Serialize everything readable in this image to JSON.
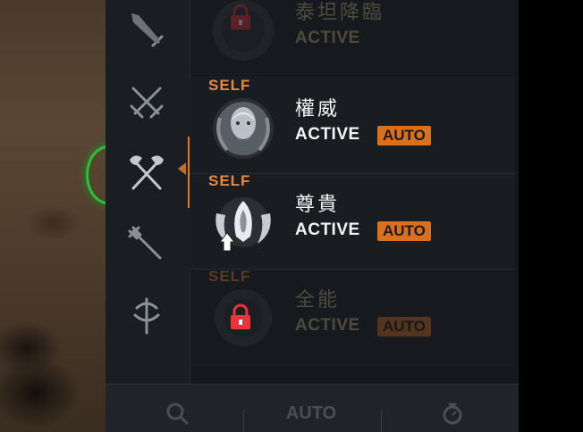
{
  "sidebar": {
    "categories": [
      {
        "name": "sword",
        "icon": "sword-icon"
      },
      {
        "name": "crossed-swords",
        "icon": "crossed-swords-icon"
      },
      {
        "name": "crossed-axes",
        "icon": "crossed-axes-icon",
        "selected": true
      },
      {
        "name": "trident",
        "icon": "trident-icon"
      },
      {
        "name": "staff",
        "icon": "staff-icon"
      }
    ]
  },
  "skills": [
    {
      "name": "泰坦降臨",
      "status": "ACTIVE",
      "locked": true,
      "self": "",
      "auto": ""
    },
    {
      "name": "權威",
      "status": "ACTIVE",
      "locked": false,
      "self": "SELF",
      "auto": "AUTO"
    },
    {
      "name": "尊貴",
      "status": "ACTIVE",
      "locked": false,
      "self": "SELF",
      "auto": "AUTO"
    },
    {
      "name": "全能",
      "status": "ACTIVE",
      "locked": true,
      "self": "SELF",
      "auto": "AUTO"
    }
  ],
  "bottom_bar": {
    "search_icon": "magnifier-icon",
    "auto_label": "AUTO",
    "timer_icon": "stopwatch-icon"
  },
  "colors": {
    "accent": "#d9701f",
    "self_text": "#e88a3c",
    "lock": "#e8343a",
    "selection_ring": "#2bbf3a"
  }
}
